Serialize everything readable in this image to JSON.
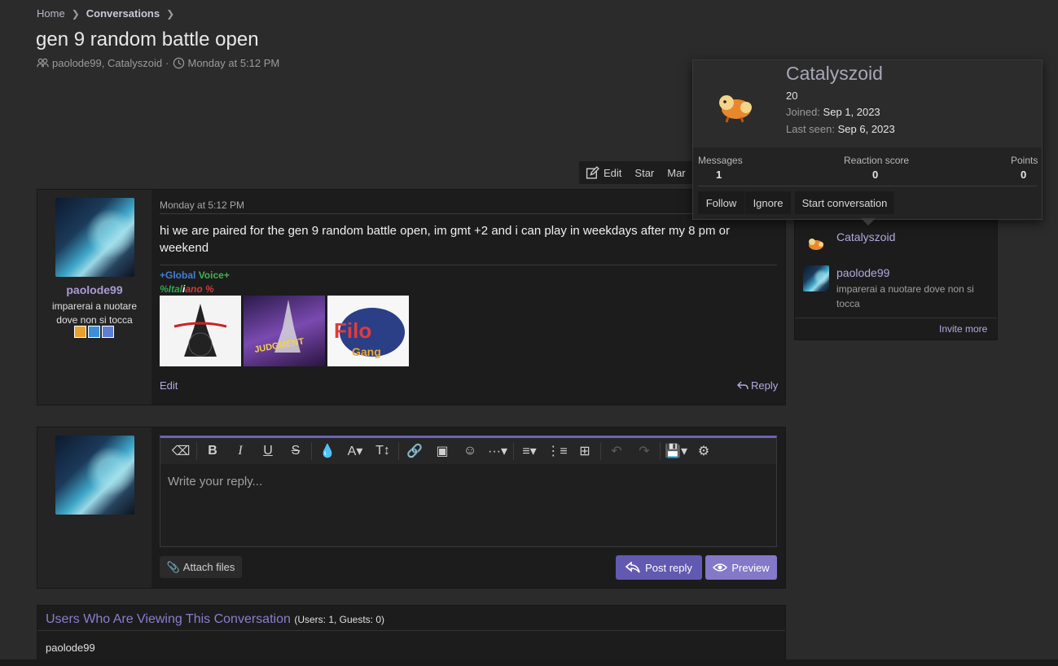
{
  "breadcrumb": {
    "home": "Home",
    "conversations": "Conversations"
  },
  "page": {
    "title": "gen 9 random battle open",
    "participants": "paolode99, Catalyszoid",
    "dot": "·",
    "time": "Monday at 5:12 PM"
  },
  "actions": {
    "edit": "Edit",
    "star": "Star",
    "mark": "Mar"
  },
  "message": {
    "author": "paolode99",
    "user_title": "imparerai a nuotare dove non si tocca",
    "date": "Monday at 5:12 PM",
    "text": "hi we are paired for the gen 9 random battle open, im gmt +2 and i can play in weekdays after my 8 pm or weekend",
    "sig_line1_a": "+Global ",
    "sig_line1_b": "Voice+",
    "sig_line2_a": "%Ital",
    "sig_line2_b": "i",
    "sig_line2_c": "ano %",
    "edit": "Edit",
    "reply": "Reply",
    "colors": {
      "global": "#3e7fd6",
      "voice": "#3fb34f",
      "italia_green": "#2fa84f",
      "italia_white": "#ffffff",
      "italia_red": "#d13a3a"
    }
  },
  "editor": {
    "placeholder": "Write your reply...",
    "attach": "Attach files",
    "post": "Post reply",
    "preview": "Preview",
    "accent": "#6b63b5"
  },
  "viewing": {
    "title": "Users Who Are Viewing This Conversation",
    "counts": "(Users: 1, Guests: 0)",
    "user": "paolode99"
  },
  "participants": [
    {
      "name": "Catalyszoid",
      "sub": ""
    },
    {
      "name": "paolode99",
      "sub": "imparerai a nuotare dove non si tocca"
    }
  ],
  "invite": "Invite more",
  "card": {
    "name": "Catalyszoid",
    "age": "20",
    "joined_label": "Joined:",
    "joined": "Sep 1, 2023",
    "seen_label": "Last seen:",
    "seen": "Sep 6, 2023",
    "messages_label": "Messages",
    "messages": "1",
    "reaction_label": "Reaction score",
    "reaction": "0",
    "points_label": "Points",
    "points": "0",
    "follow": "Follow",
    "ignore": "Ignore",
    "start": "Start conversation"
  }
}
